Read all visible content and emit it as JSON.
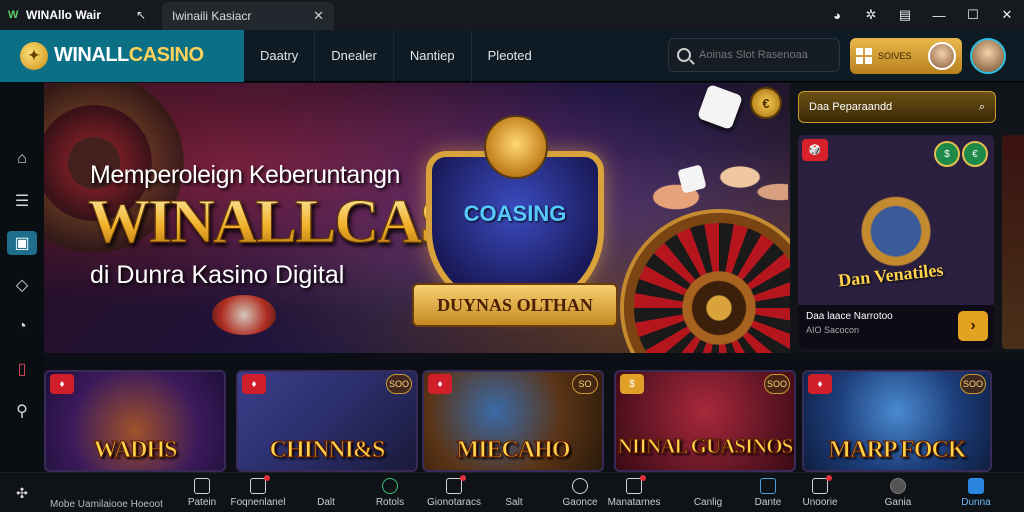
{
  "titlebar": {
    "app_name": "WINAllo Wair",
    "tab_label": "Iwinaili Kasiacr",
    "icons": [
      "back-arrow-icon",
      "chart-icon",
      "extension-icon",
      "notes-icon",
      "minimize-icon",
      "maximize-icon",
      "close-icon"
    ]
  },
  "header": {
    "logo_main": "WINALL",
    "logo_accent": "CASINO",
    "nav": [
      "Daatry",
      "Dnealer",
      "Nantiep",
      "Pleoted"
    ],
    "search_placeholder": "Aoinas Slot Rasenoaa",
    "account_label": "SOIVES"
  },
  "sidebar": {
    "icons": [
      "home-icon",
      "list-icon",
      "wallet-icon",
      "tag-icon",
      "timer-icon",
      "book-icon",
      "pin-icon"
    ],
    "active_index": 2
  },
  "hero": {
    "line1": "Memperoleign Keberuntangn",
    "line2": "WINALLCASIINO",
    "line3": "di Dunra Kasino Digital",
    "emblem_title": "COASING",
    "emblem_ribbon": "DUYNAS OLTHAN",
    "coin_label": "€"
  },
  "right_panel": {
    "search_label": "Daa Peparaandd",
    "card_title": "Dan Venatiles",
    "card_name": "Daa laace Narrotoo",
    "card_sub": "AIO Sacocon",
    "badge": "🎲",
    "chips": [
      "$",
      "€",
      "¥"
    ]
  },
  "tiles": [
    {
      "title": "WADHS",
      "count": "",
      "bg": "#3b1a5c"
    },
    {
      "title": "CHINNI&S",
      "count": "SOO",
      "bg": "#2b2e6a"
    },
    {
      "title": "MIECAHO",
      "count": "SO",
      "bg": "#5a3416"
    },
    {
      "title": "NIINAL GUASINOS",
      "count": "SOO",
      "bg": "#6a1828"
    },
    {
      "title": "MARP FOCK",
      "count": "SOO",
      "bg": "#1d3e7a"
    }
  ],
  "bottombar": {
    "status": "Mobe Uamilaiooe Hoeoot",
    "items": [
      {
        "label": "Patein",
        "icon": "chip-icon",
        "dot": false
      },
      {
        "label": "Foqnenlanel",
        "icon": "screen-icon",
        "dot": true
      },
      {
        "label": "Dalt",
        "icon": "",
        "dot": false
      },
      {
        "label": "Rotols",
        "icon": "ring-icon",
        "dot": false
      },
      {
        "label": "Gionotaracs",
        "icon": "gift-icon",
        "dot": true
      },
      {
        "label": "Salt",
        "icon": "",
        "dot": false
      },
      {
        "label": "Gaonce",
        "icon": "clock-icon",
        "dot": false
      },
      {
        "label": "Manatarnes",
        "icon": "photo-icon",
        "dot": true
      },
      {
        "label": "Canlig",
        "icon": "",
        "dot": false
      },
      {
        "label": "Dante",
        "icon": "calendar-icon",
        "dot": false
      },
      {
        "label": "Unoorie",
        "icon": "share-icon",
        "dot": true
      },
      {
        "label": "Gania",
        "icon": "chat-icon",
        "dot": false
      },
      {
        "label": "Dunna",
        "icon": "user-icon",
        "dot": false
      }
    ],
    "active_index": 12
  },
  "colors": {
    "accent": "#0b6f86",
    "gold": "#e3a21f",
    "active_blue": "#2a86e0",
    "badge_red": "#d01f2a"
  }
}
